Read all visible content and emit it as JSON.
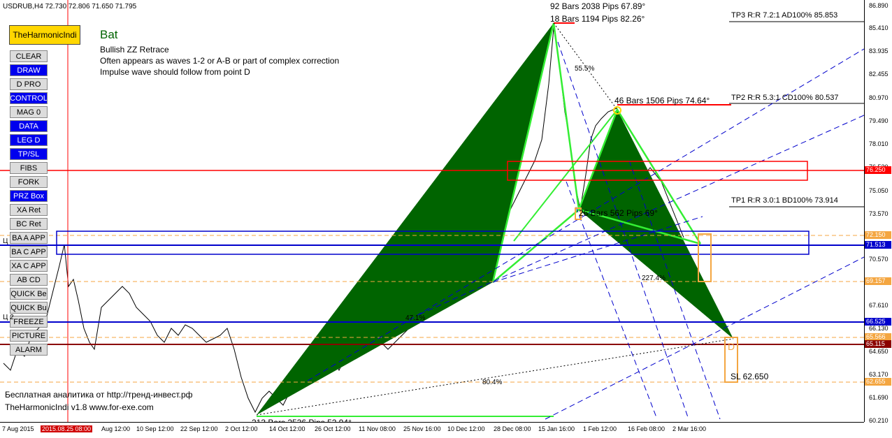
{
  "window": {
    "title": "USDRUB,H4  72.730 72.806 71.650 71.795"
  },
  "indicator": {
    "name": "TheHarmonicIndi",
    "footer1": "Бесплатная аналитика от http://тренд-инвест.рф",
    "footer2": "TheHarmonicIndi v1.8 www.for-exe.com"
  },
  "pattern": {
    "name": "Bat",
    "desc1": "Bullish ZZ Retrace",
    "desc2": "Often appears as waves 1-2 or A-B or part of complex correction",
    "desc3": "Impulse wave should follow from point D"
  },
  "buttons": [
    {
      "label": "CLEAR",
      "active": false
    },
    {
      "label": "DRAW",
      "active": true
    },
    {
      "label": "D PRO",
      "active": false
    },
    {
      "label": "CONTROL",
      "active": true
    },
    {
      "label": "MAG 0",
      "active": false
    },
    {
      "label": "DATA",
      "active": true
    },
    {
      "label": "LEG D",
      "active": true
    },
    {
      "label": "TP/SL",
      "active": true
    },
    {
      "label": "FIBS",
      "active": false
    },
    {
      "label": "FORK",
      "active": false
    },
    {
      "label": "PRZ Box",
      "active": true
    },
    {
      "label": "XA Ret",
      "active": false
    },
    {
      "label": "BC Ret",
      "active": false
    },
    {
      "label": "BA A APP",
      "active": false
    },
    {
      "label": "BA C APP",
      "active": false
    },
    {
      "label": "XA C APP",
      "active": false
    },
    {
      "label": "AB CD",
      "active": false
    },
    {
      "label": "QUICK Be",
      "active": false
    },
    {
      "label": "QUICK Bu",
      "active": false
    },
    {
      "label": "FREEZE",
      "active": false
    },
    {
      "label": "PICTURE",
      "active": false
    },
    {
      "label": "ALARM",
      "active": false
    }
  ],
  "targets": {
    "tp3": "TP3  R:R 7.2:1  AD100%  85.853",
    "tp2": "TP2  R:R 5.3:1  CD100%  80.537",
    "tp1": "TP1  R:R 3.0:1  BD100%  73.914",
    "sl": "SL 62.650"
  },
  "annotations": {
    "a_top1": "92 Bars  2038 Pips  67.89°",
    "a_top2": "18 Bars  1194 Pips  82.26°",
    "c_label": "46 Bars  1506 Pips  74.64°",
    "b_label": "26 Bars  562 Pips  69°",
    "x_label": "213 Bars  2536 Pips  52.94°",
    "pct_ab": "55.5%",
    "pct_cd": "227.4%",
    "pct_ad": "80.4%",
    "pct_small": "47.1%",
    "point_d": "D",
    "left_label1": "Ц",
    "left_label2": "Ц 2"
  },
  "price_axis": {
    "ticks": [
      "86.890",
      "85.410",
      "83.935",
      "82.455",
      "80.970",
      "79.490",
      "78.010",
      "76.530",
      "75.050",
      "73.570",
      "72.090",
      "70.570",
      "69.090",
      "67.610",
      "66.130",
      "64.650",
      "63.170",
      "61.690",
      "60.210"
    ],
    "tags": [
      {
        "value": "76.250",
        "color": "#ff0000"
      },
      {
        "value": "72.150",
        "color": "#f4a641"
      },
      {
        "value": "71.513",
        "color": "#0000cc"
      },
      {
        "value": "69.157",
        "color": "#f4a641"
      },
      {
        "value": "66.525",
        "color": "#0000cc"
      },
      {
        "value": "65.566",
        "color": "#f4a641"
      },
      {
        "value": "65.115",
        "color": "#8b0000"
      },
      {
        "value": "62.655",
        "color": "#f4a641"
      }
    ]
  },
  "time_axis": {
    "ticks": [
      {
        "label": "7 Aug 2015",
        "hl": false
      },
      {
        "label": "2015.08.25 08:00",
        "hl": true
      },
      {
        "label": "Aug 12:00",
        "hl": false
      },
      {
        "label": "10 Sep 12:00",
        "hl": false
      },
      {
        "label": "22 Sep 12:00",
        "hl": false
      },
      {
        "label": "2 Oct 12:00",
        "hl": false
      },
      {
        "label": "14 Oct 12:00",
        "hl": false
      },
      {
        "label": "26 Oct 12:00",
        "hl": false
      },
      {
        "label": "11 Nov 08:00",
        "hl": false
      },
      {
        "label": "25 Nov 16:00",
        "hl": false
      },
      {
        "label": "10 Dec 12:00",
        "hl": false
      },
      {
        "label": "28 Dec 08:00",
        "hl": false
      },
      {
        "label": "15 Jan 16:00",
        "hl": false
      },
      {
        "label": "1 Feb 12:00",
        "hl": false
      },
      {
        "label": "16 Feb 08:00",
        "hl": false
      },
      {
        "label": "2 Mar 16:00",
        "hl": false
      }
    ]
  },
  "colors": {
    "pattern_fill": "#006400",
    "legs": "#33ee33",
    "red": "#ff0000",
    "blue": "#0000cc",
    "orange": "#f4a641",
    "darkred": "#8b0000"
  }
}
